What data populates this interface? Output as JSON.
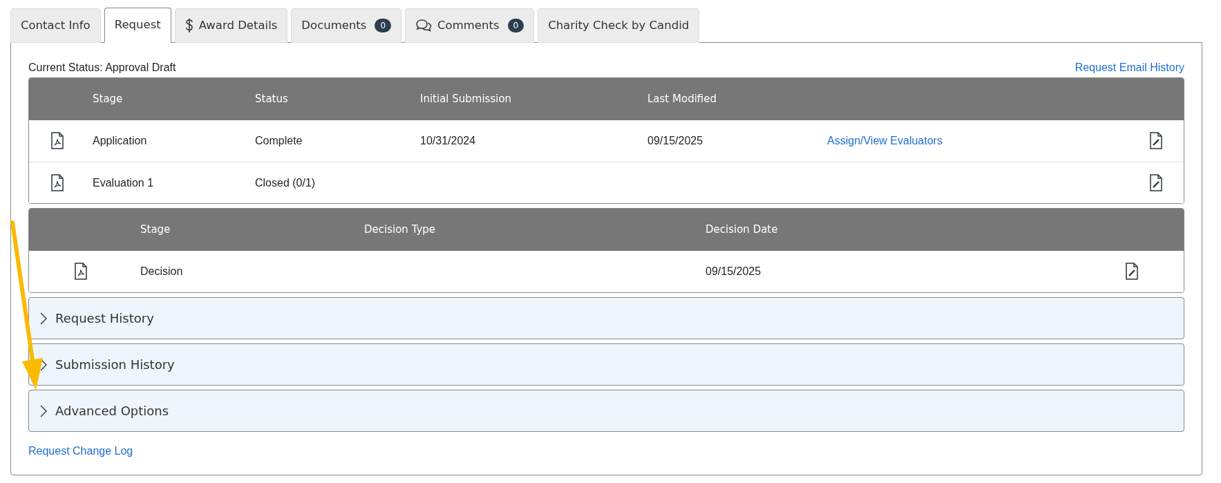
{
  "tabs": [
    {
      "label": "Contact Info",
      "selected": false,
      "kind": "plain"
    },
    {
      "label": "Request",
      "selected": true,
      "kind": "plain"
    },
    {
      "label": "Award Details",
      "selected": false,
      "kind": "currency"
    },
    {
      "label": "Documents",
      "selected": false,
      "kind": "plain",
      "badge": "0"
    },
    {
      "label": "Comments",
      "selected": false,
      "kind": "discussion",
      "badge": "0"
    },
    {
      "label": "Charity Check by Candid",
      "selected": false,
      "kind": "plain"
    }
  ],
  "current_status": "Current Status: Approval Draft",
  "email_history_link": "Request Email History",
  "stages_table": {
    "columns": [
      "Stage",
      "Status",
      "Initial Submission",
      "Last Modified"
    ],
    "rows": [
      {
        "stage": "Application",
        "status": "Complete",
        "initial_submission": "10/31/2024",
        "last_modified": "09/15/2025",
        "action_link": "Assign/View Evaluators"
      },
      {
        "stage": "Evaluation 1",
        "status": "Closed (0/1)"
      }
    ]
  },
  "decision_table": {
    "columns": [
      "Stage",
      "Decision Type",
      "Decision Date"
    ],
    "rows": [
      {
        "stage": "Decision",
        "decision_date": "09/15/2025"
      }
    ]
  },
  "sections": [
    {
      "title": "Request History",
      "expanded": false
    },
    {
      "title": "Submission History",
      "expanded": false
    },
    {
      "title": "Advanced Options",
      "expanded": false
    }
  ],
  "change_log_link": "Request Change Log"
}
